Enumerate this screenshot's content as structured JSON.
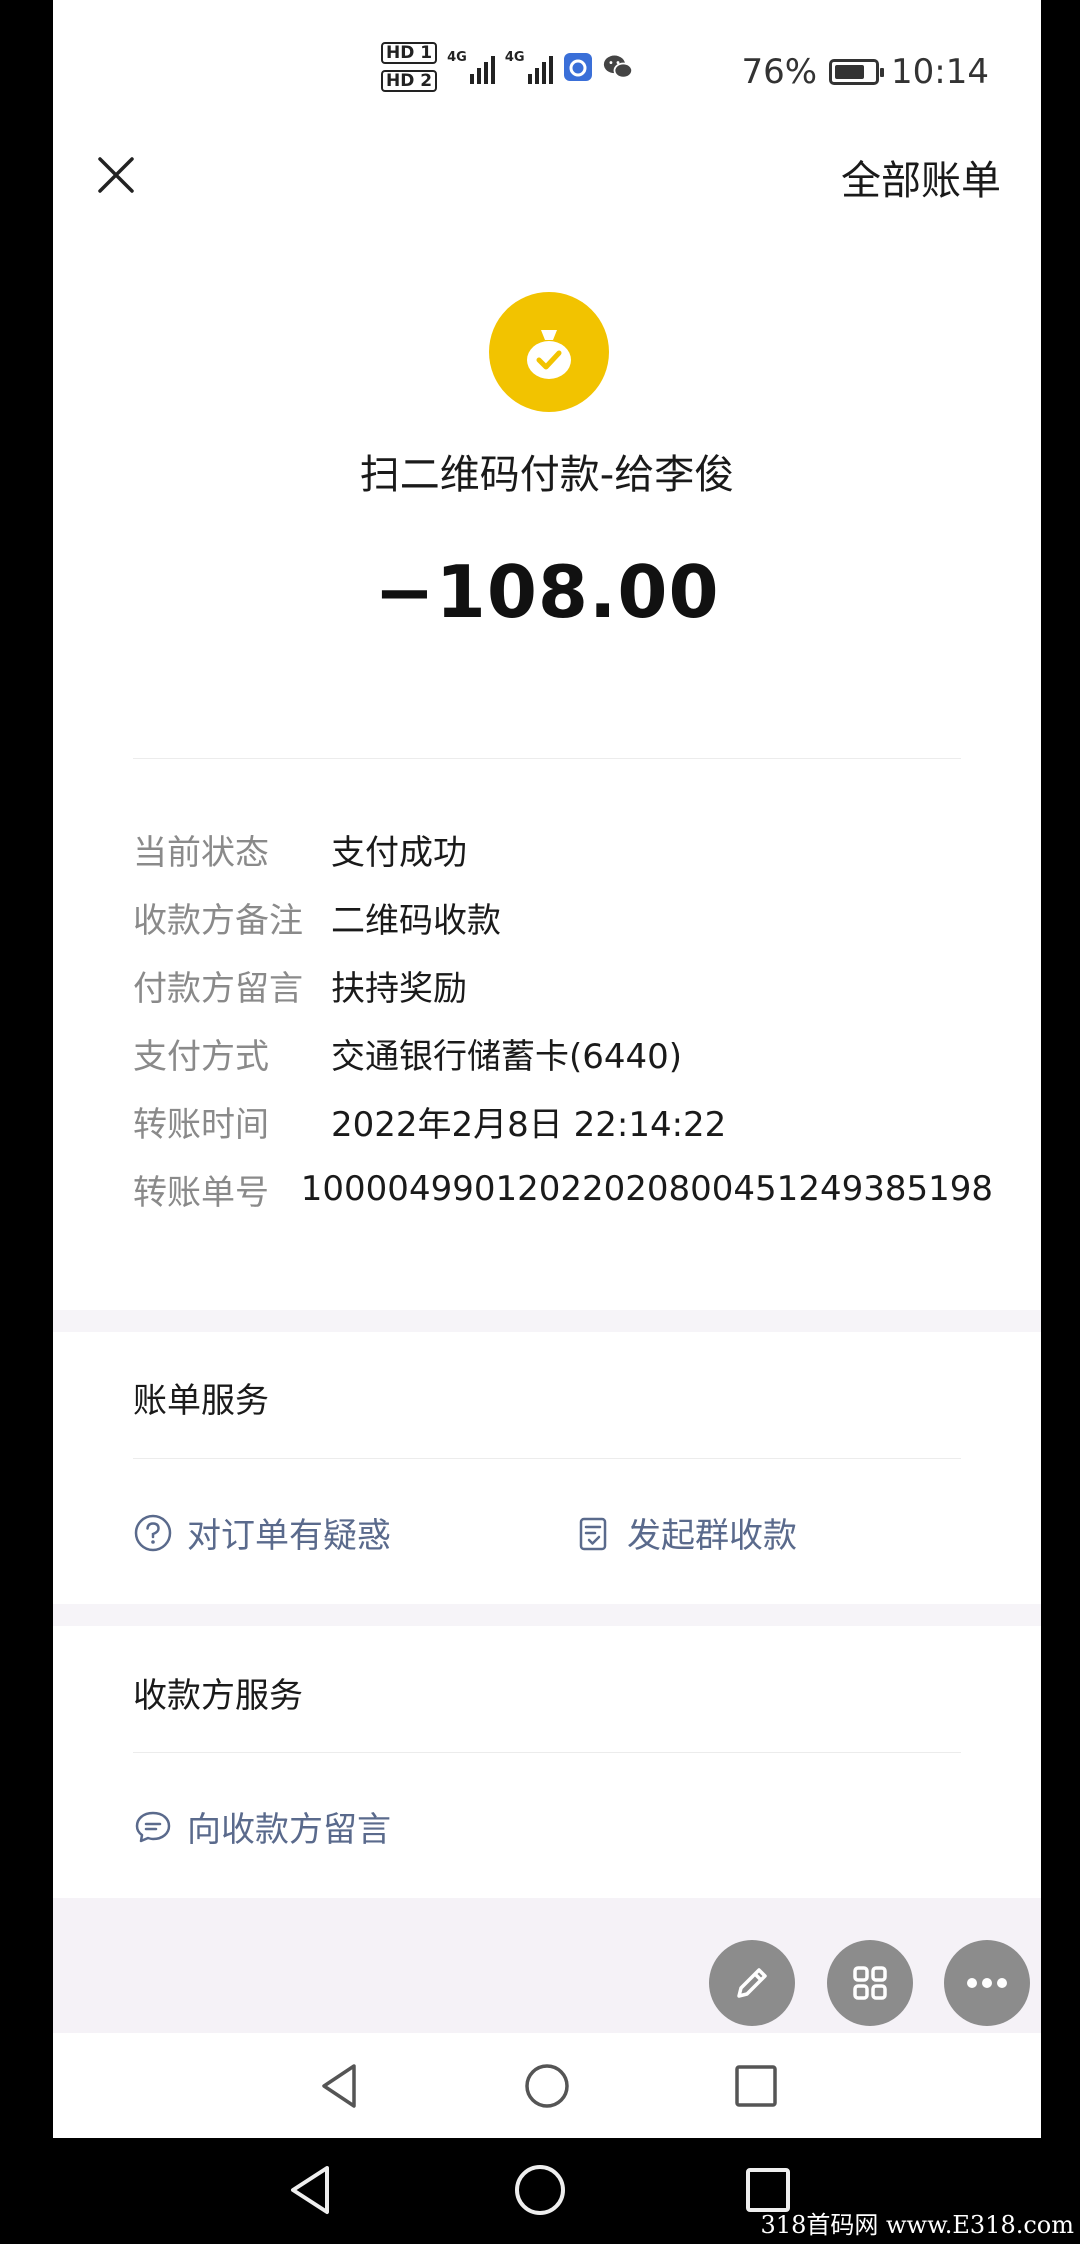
{
  "status_bar": {
    "hd1": "HD 1",
    "hd2": "HD 2",
    "net1": "4G",
    "net2": "4G",
    "battery": "76%",
    "battery_level": 0.76,
    "time": "10:14"
  },
  "header": {
    "close_icon": "close-icon",
    "all_bills": "全部账单"
  },
  "hero": {
    "icon": "money-bag-check-icon",
    "icon_color": "#f2c300",
    "merchant": "扫二维码付款-给李俊",
    "amount": "−108.00"
  },
  "details": [
    {
      "key": "当前状态",
      "value": "支付成功"
    },
    {
      "key": "收款方备注",
      "value": "二维码收款"
    },
    {
      "key": "付款方留言",
      "value": "扶持奖励"
    },
    {
      "key": "支付方式",
      "value": "交通银行储蓄卡(6440)"
    },
    {
      "key": "转账时间",
      "value": "2022年2月8日 22:14:22"
    },
    {
      "key": "转账单号",
      "value": "100004990120220208004512493851​98"
    }
  ],
  "bill_service": {
    "title": "账单服务",
    "question": "对订单有疑惑",
    "group_collect": "发起群收款"
  },
  "payee_service": {
    "title": "收款方服务",
    "message": "向收款方留言"
  },
  "fabs": [
    "pencil-icon",
    "grid-icon",
    "more-icon"
  ],
  "watermark": "318首码网 www.E318.com",
  "colors": {
    "accent_link": "#5a6a8c",
    "label_gray": "#8a8a8a"
  }
}
